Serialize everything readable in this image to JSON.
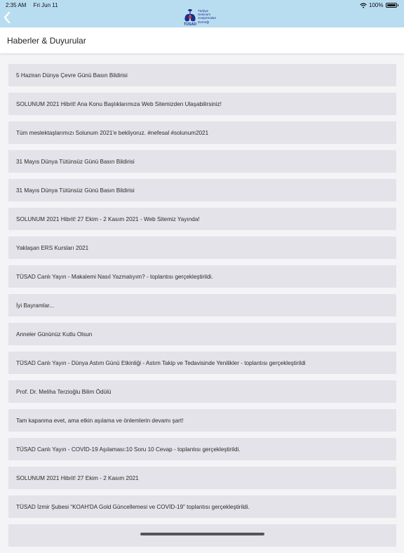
{
  "status_bar": {
    "time": "2:35 AM",
    "date": "Fri Jun 11",
    "battery": "100%",
    "icons": [
      "wifi-icon",
      "battery-icon"
    ]
  },
  "nav": {
    "back_icon": "chevron-left-icon",
    "logo": {
      "lines": [
        "Türkiye",
        "Solunum",
        "Araştırmaları",
        "Derneği"
      ],
      "acronym": "TÜSAD"
    }
  },
  "page": {
    "title": "Haberler & Duyurular"
  },
  "colors": {
    "nav_background": "#b9ddf0",
    "accent": "#1d2d8c",
    "item_background": "#e4e3ea",
    "page_background": "#f4f4f6"
  },
  "news": [
    "5 Haziran Dünya Çevre Günü Basın Bildirisi",
    "SOLUNUM 2021 Hibrit! Ana Konu Başlıklarımıza Web Sitemizden Ulaşabilirsiniz!",
    "Tüm meslektaşlarımızı Solunum 2021'e bekliyoruz. #nefesal #solunum2021",
    "31 Mayıs Dünya Tütünsüz Günü Basın Bildirisi",
    "31 Mayıs Dünya Tütünsüz Günü Basın Bildirisi",
    "SOLUNUM 2021 Hibrit! 27 Ekim - 2 Kasım 2021 - Web Sitemiz Yayında!",
    "Yaklaşan ERS Kursları 2021",
    "TÜSAD Canlı Yayın - Makalemi Nasıl Yazmalıyım? - toplantısı gerçekleştirildi.",
    "İyi Bayramlar...",
    "Anneler Gününüz Kutlu Olsun",
    "TÜSAD Canlı Yayın - Dünya Astım Günü Etkinliği - Astım Takip ve Tedavisinde Yenilikler - toplantısı gerçekleştirildi",
    "Prof. Dr. Meliha Terzioğlu Bilim Ödülü",
    "Tam kapanma evet, ama etkin aşılama ve önlemlerin devamı şart!",
    "TÜSAD Canlı Yayın - COVİD-19 Aşılaması:10 Soru 10 Cevap - toplantısı gerçekleştirildi.",
    "SOLUNUM 2021 Hibrit! 27 Ekim - 2 Kasım 2021",
    "TÜSAD İzmir Şubesi “KOAH'DA Gold Güncellemesi ve COVİD-19” toplantısı gerçekleştirildi.",
    ""
  ]
}
